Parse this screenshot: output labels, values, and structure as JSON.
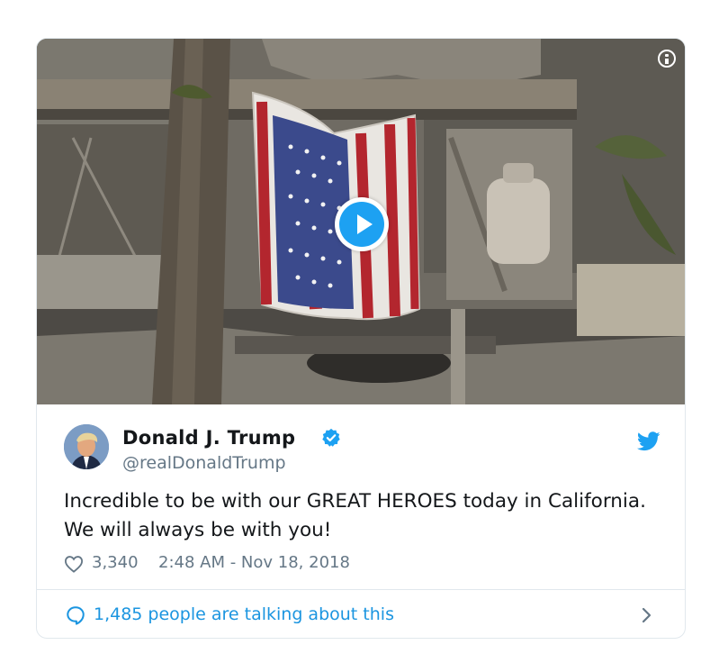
{
  "tweet": {
    "author_name": "Donald J. Trump",
    "handle": "@realDonaldTrump",
    "text": "Incredible to be with our GREAT HEROES today in California. We will always be with you!",
    "like_count": "3,340",
    "timestamp": "2:48 AM - Nov 18, 2018",
    "talking_text": "1,485 people are talking about this"
  },
  "icons": {
    "info": "info-icon",
    "play": "play-icon",
    "verified": "verified-badge-icon",
    "twitter": "twitter-bird-icon",
    "heart": "heart-icon",
    "chat": "chat-bubble-icon",
    "chevron": "chevron-right-icon"
  },
  "colors": {
    "accent": "#1da1f2",
    "link": "#1b95e0",
    "secondary_text": "#657786",
    "border": "#e1e8ed"
  }
}
